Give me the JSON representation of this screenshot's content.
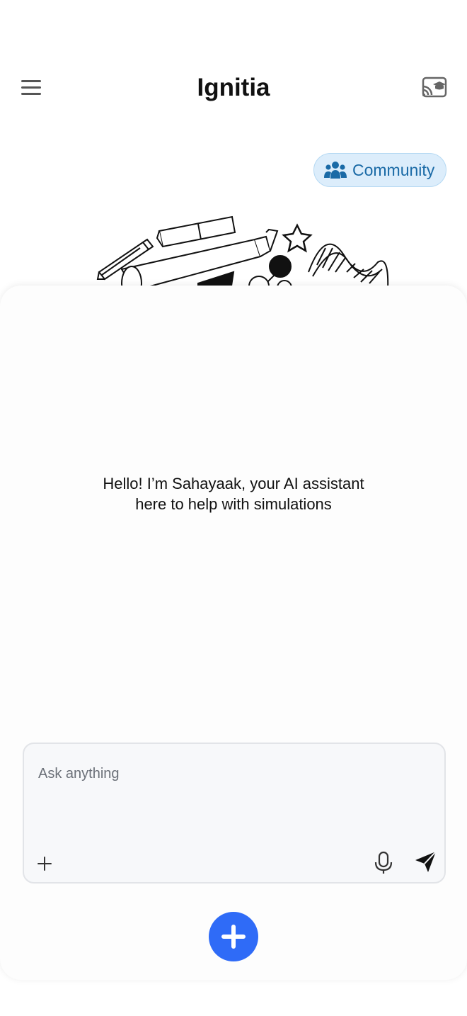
{
  "header": {
    "title": "Ignitia",
    "menu_icon": "hamburger-menu-icon",
    "cast_icon": "cast-classroom-icon"
  },
  "community": {
    "label": "Community",
    "icon": "people-group-icon",
    "bg_color": "#dcedfb",
    "text_color": "#1a6aa6"
  },
  "illustration": {
    "icons": [
      "pencil-icon",
      "eraser-icon",
      "telescope-icon",
      "star-icon",
      "molecule-icon",
      "dna-icon"
    ]
  },
  "chat": {
    "greeting_line1": "Hello! I’m Sahayaak, your AI assistant",
    "greeting_line2": "here to help with simulations"
  },
  "composer": {
    "placeholder": "Ask anything",
    "attach_icon": "plus-icon",
    "mic_icon": "microphone-icon",
    "send_icon": "send-icon"
  },
  "fab": {
    "icon": "plus-circle-icon",
    "color": "#2f6bf7"
  }
}
